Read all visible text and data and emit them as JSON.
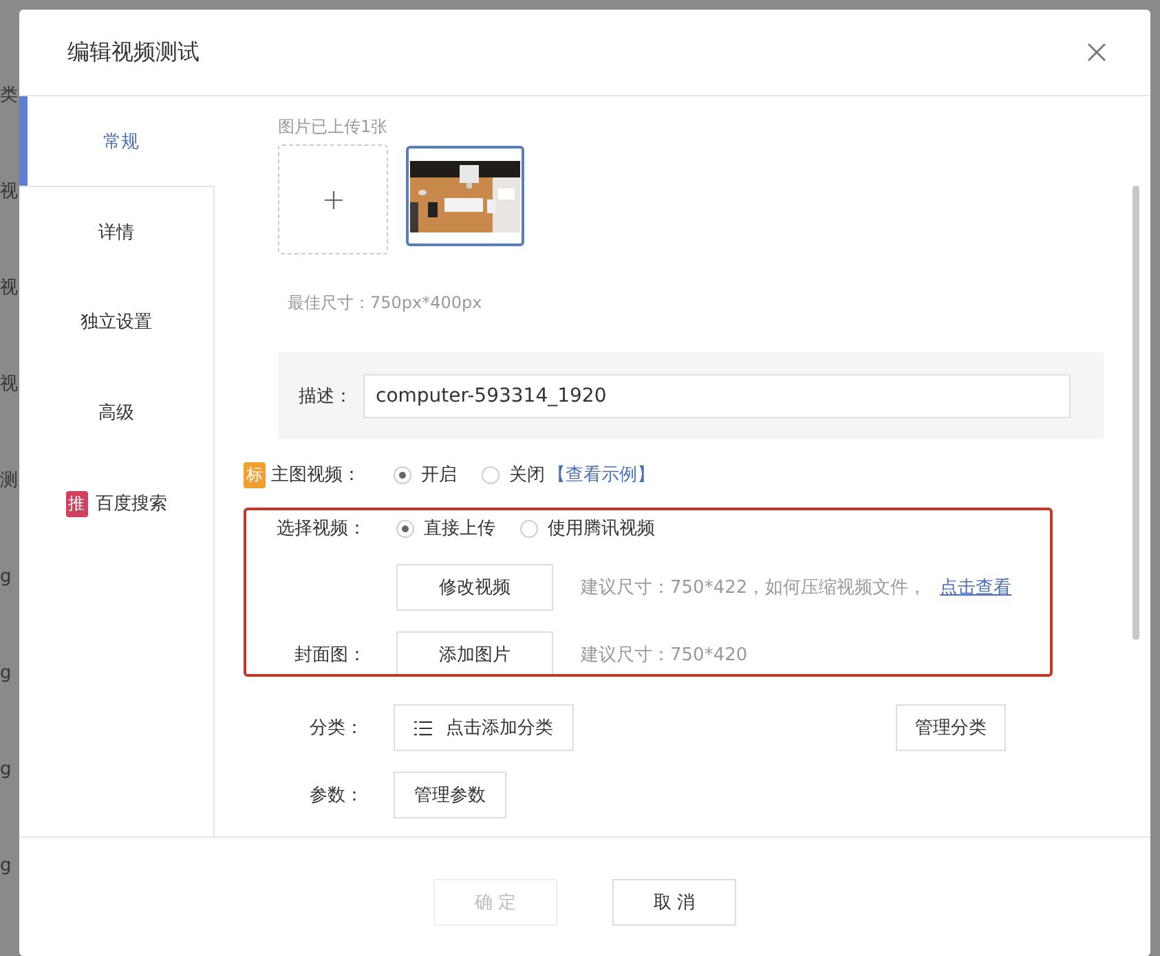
{
  "background": {
    "column": [
      "类",
      "视",
      "视",
      "视",
      "测",
      "g",
      "g",
      "g",
      "g"
    ]
  },
  "dialog": {
    "title": "编辑视频测试"
  },
  "tabs": [
    {
      "label": "常规",
      "selected": true
    },
    {
      "label": "详情",
      "selected": false
    },
    {
      "label": "独立设置",
      "selected": false
    },
    {
      "label": "高级",
      "selected": false
    },
    {
      "label": "百度搜索",
      "selected": false,
      "badge": "推"
    }
  ],
  "images": {
    "caption": "图片已上传1张",
    "thumbnails": [
      {
        "kind": "picture",
        "selected": true
      }
    ],
    "hint": "最佳尺寸：750px*400px"
  },
  "description": {
    "label": "描述：",
    "value": "computer-593314_1920"
  },
  "main_video": {
    "badge": "标",
    "label": "主图视频：",
    "options": [
      {
        "label": "开启",
        "selected": true
      },
      {
        "label": "关闭",
        "selected": false
      }
    ],
    "link": "【查看示例】"
  },
  "highlighted_section": {
    "select_video": {
      "label": "选择视频：",
      "options": [
        {
          "label": "直接上传",
          "selected": true
        },
        {
          "label": "使用腾讯视频",
          "selected": false
        }
      ]
    },
    "video_button": "修改视频",
    "video_hint": "建议尺寸：750*422，如何压缩视频文件，",
    "video_link": "点击查看",
    "cover": {
      "label": "封面图：",
      "button": "添加图片",
      "hint": "建议尺寸：750*420"
    }
  },
  "category": {
    "label": "分类：",
    "button": "点击添加分类",
    "manage": "管理分类"
  },
  "params": {
    "label": "参数：",
    "button": "管理参数"
  },
  "footer": [
    {
      "label": "确 定",
      "disabled": true
    },
    {
      "label": "取 消",
      "disabled": false
    }
  ]
}
